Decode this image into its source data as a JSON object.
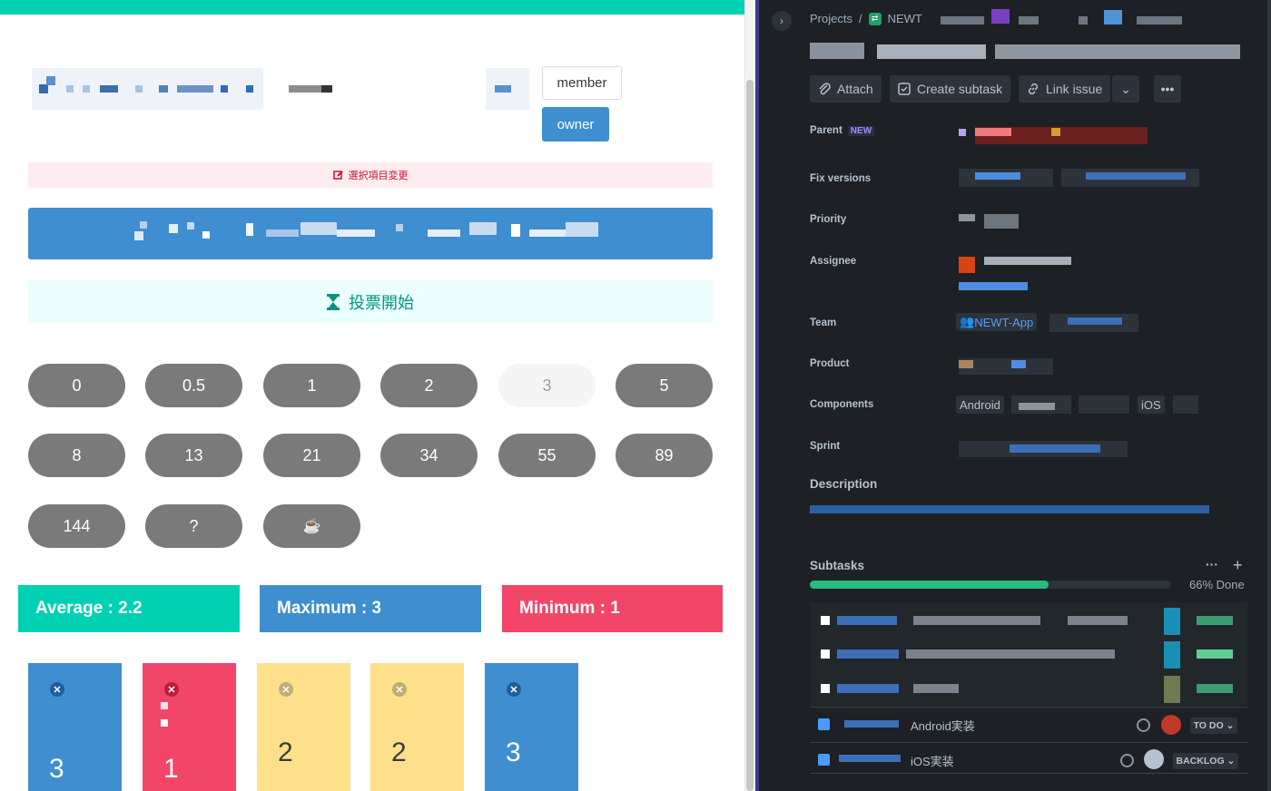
{
  "left": {
    "role_buttons": {
      "member": "member",
      "owner": "owner"
    },
    "notice": {
      "icon": "edit-icon",
      "text": "選択項目変更"
    },
    "start_vote": {
      "icon": "hourglass-icon",
      "text": "投票開始"
    },
    "cards": [
      "0",
      "0.5",
      "1",
      "2",
      "3",
      "5",
      "8",
      "13",
      "21",
      "34",
      "55",
      "89",
      "144",
      "?",
      "☕"
    ],
    "selected_card": "3",
    "stats": {
      "average": "Average : 2.2",
      "maximum": "Maximum : 3",
      "minimum": "Minimum : 1"
    },
    "votes": [
      "3",
      "1",
      "2",
      "2",
      "3"
    ],
    "colors": {
      "teal": "#00d1b2",
      "blue": "#3e8ed0",
      "red": "#f14668",
      "yellow": "#ffe08a",
      "grey": "#7a7a7a"
    }
  },
  "right": {
    "breadcrumb": {
      "projects": "Projects",
      "separator": "/",
      "project": "NEWT"
    },
    "actions": {
      "attach": "Attach",
      "create_subtask": "Create subtask",
      "link_issue": "Link issue"
    },
    "fields": {
      "parent": "Parent",
      "parent_badge": "NEW",
      "fix_versions": "Fix versions",
      "priority": "Priority",
      "assignee": "Assignee",
      "team": "Team",
      "team_value": "NEWT-App",
      "product": "Product",
      "components": "Components",
      "component_android": "Android",
      "component_ios": "iOS",
      "sprint": "Sprint"
    },
    "description": {
      "heading": "Description"
    },
    "subtasks": {
      "heading": "Subtasks",
      "progress_text": "66% Done",
      "progress_fraction": 0.66,
      "items": [
        {
          "title": "Android実装",
          "status": "TO DO"
        },
        {
          "title": "iOS実装",
          "status": "BACKLOG"
        }
      ]
    }
  }
}
